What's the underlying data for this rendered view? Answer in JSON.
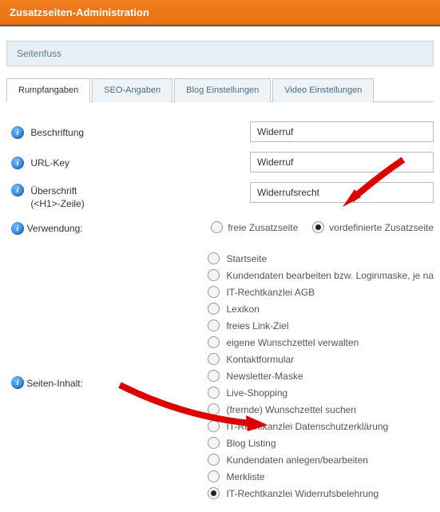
{
  "header": {
    "title": "Zusatzseiten-Administration"
  },
  "subbar": {
    "label": "Seitenfuss"
  },
  "tabs": [
    {
      "label": "Rumpfangaben",
      "active": true
    },
    {
      "label": "SEO-Angaben",
      "active": false
    },
    {
      "label": "Blog Einstellungen",
      "active": false
    },
    {
      "label": "Video Einstellungen",
      "active": false
    }
  ],
  "fields": {
    "beschriftung": {
      "label": "Beschriftung",
      "value": "Widerruf"
    },
    "urlkey": {
      "label": "URL-Key",
      "value": "Widerruf"
    },
    "ueberschrift": {
      "label_l1": "Überschrift",
      "label_l2": "(<H1>-Zeile)",
      "value": "Widerrufsrecht"
    },
    "verwendung": {
      "label": "Verwendung:",
      "options": [
        {
          "label": "freie Zusatzseite",
          "checked": false
        },
        {
          "label": "vordefinierte Zusatzseite",
          "checked": true
        }
      ]
    },
    "seiteninhalt": {
      "label": "Seiten-Inhalt:",
      "options": [
        {
          "label": "Startseite",
          "checked": false
        },
        {
          "label": "Kundendaten bearbeiten bzw. Loginmaske, je na",
          "checked": false
        },
        {
          "label": "IT-Rechtkanzlei AGB",
          "checked": false
        },
        {
          "label": "Lexikon",
          "checked": false
        },
        {
          "label": "freies Link-Ziel",
          "checked": false
        },
        {
          "label": "eigene Wunschzettel verwalten",
          "checked": false
        },
        {
          "label": "Kontaktformular",
          "checked": false
        },
        {
          "label": "Newsletter-Maske",
          "checked": false
        },
        {
          "label": "Live-Shopping",
          "checked": false
        },
        {
          "label": "(fremde) Wunschzettel suchen",
          "checked": false
        },
        {
          "label": "IT-Rechtkanzlei Datenschutzerklärung",
          "checked": false
        },
        {
          "label": "Blog Listing",
          "checked": false
        },
        {
          "label": "Kundendaten anlegen/bearbeiten",
          "checked": false
        },
        {
          "label": "Merkliste",
          "checked": false
        },
        {
          "label": "IT-Rechtkanzlei Widerrufsbelehrung",
          "checked": true
        }
      ]
    }
  }
}
